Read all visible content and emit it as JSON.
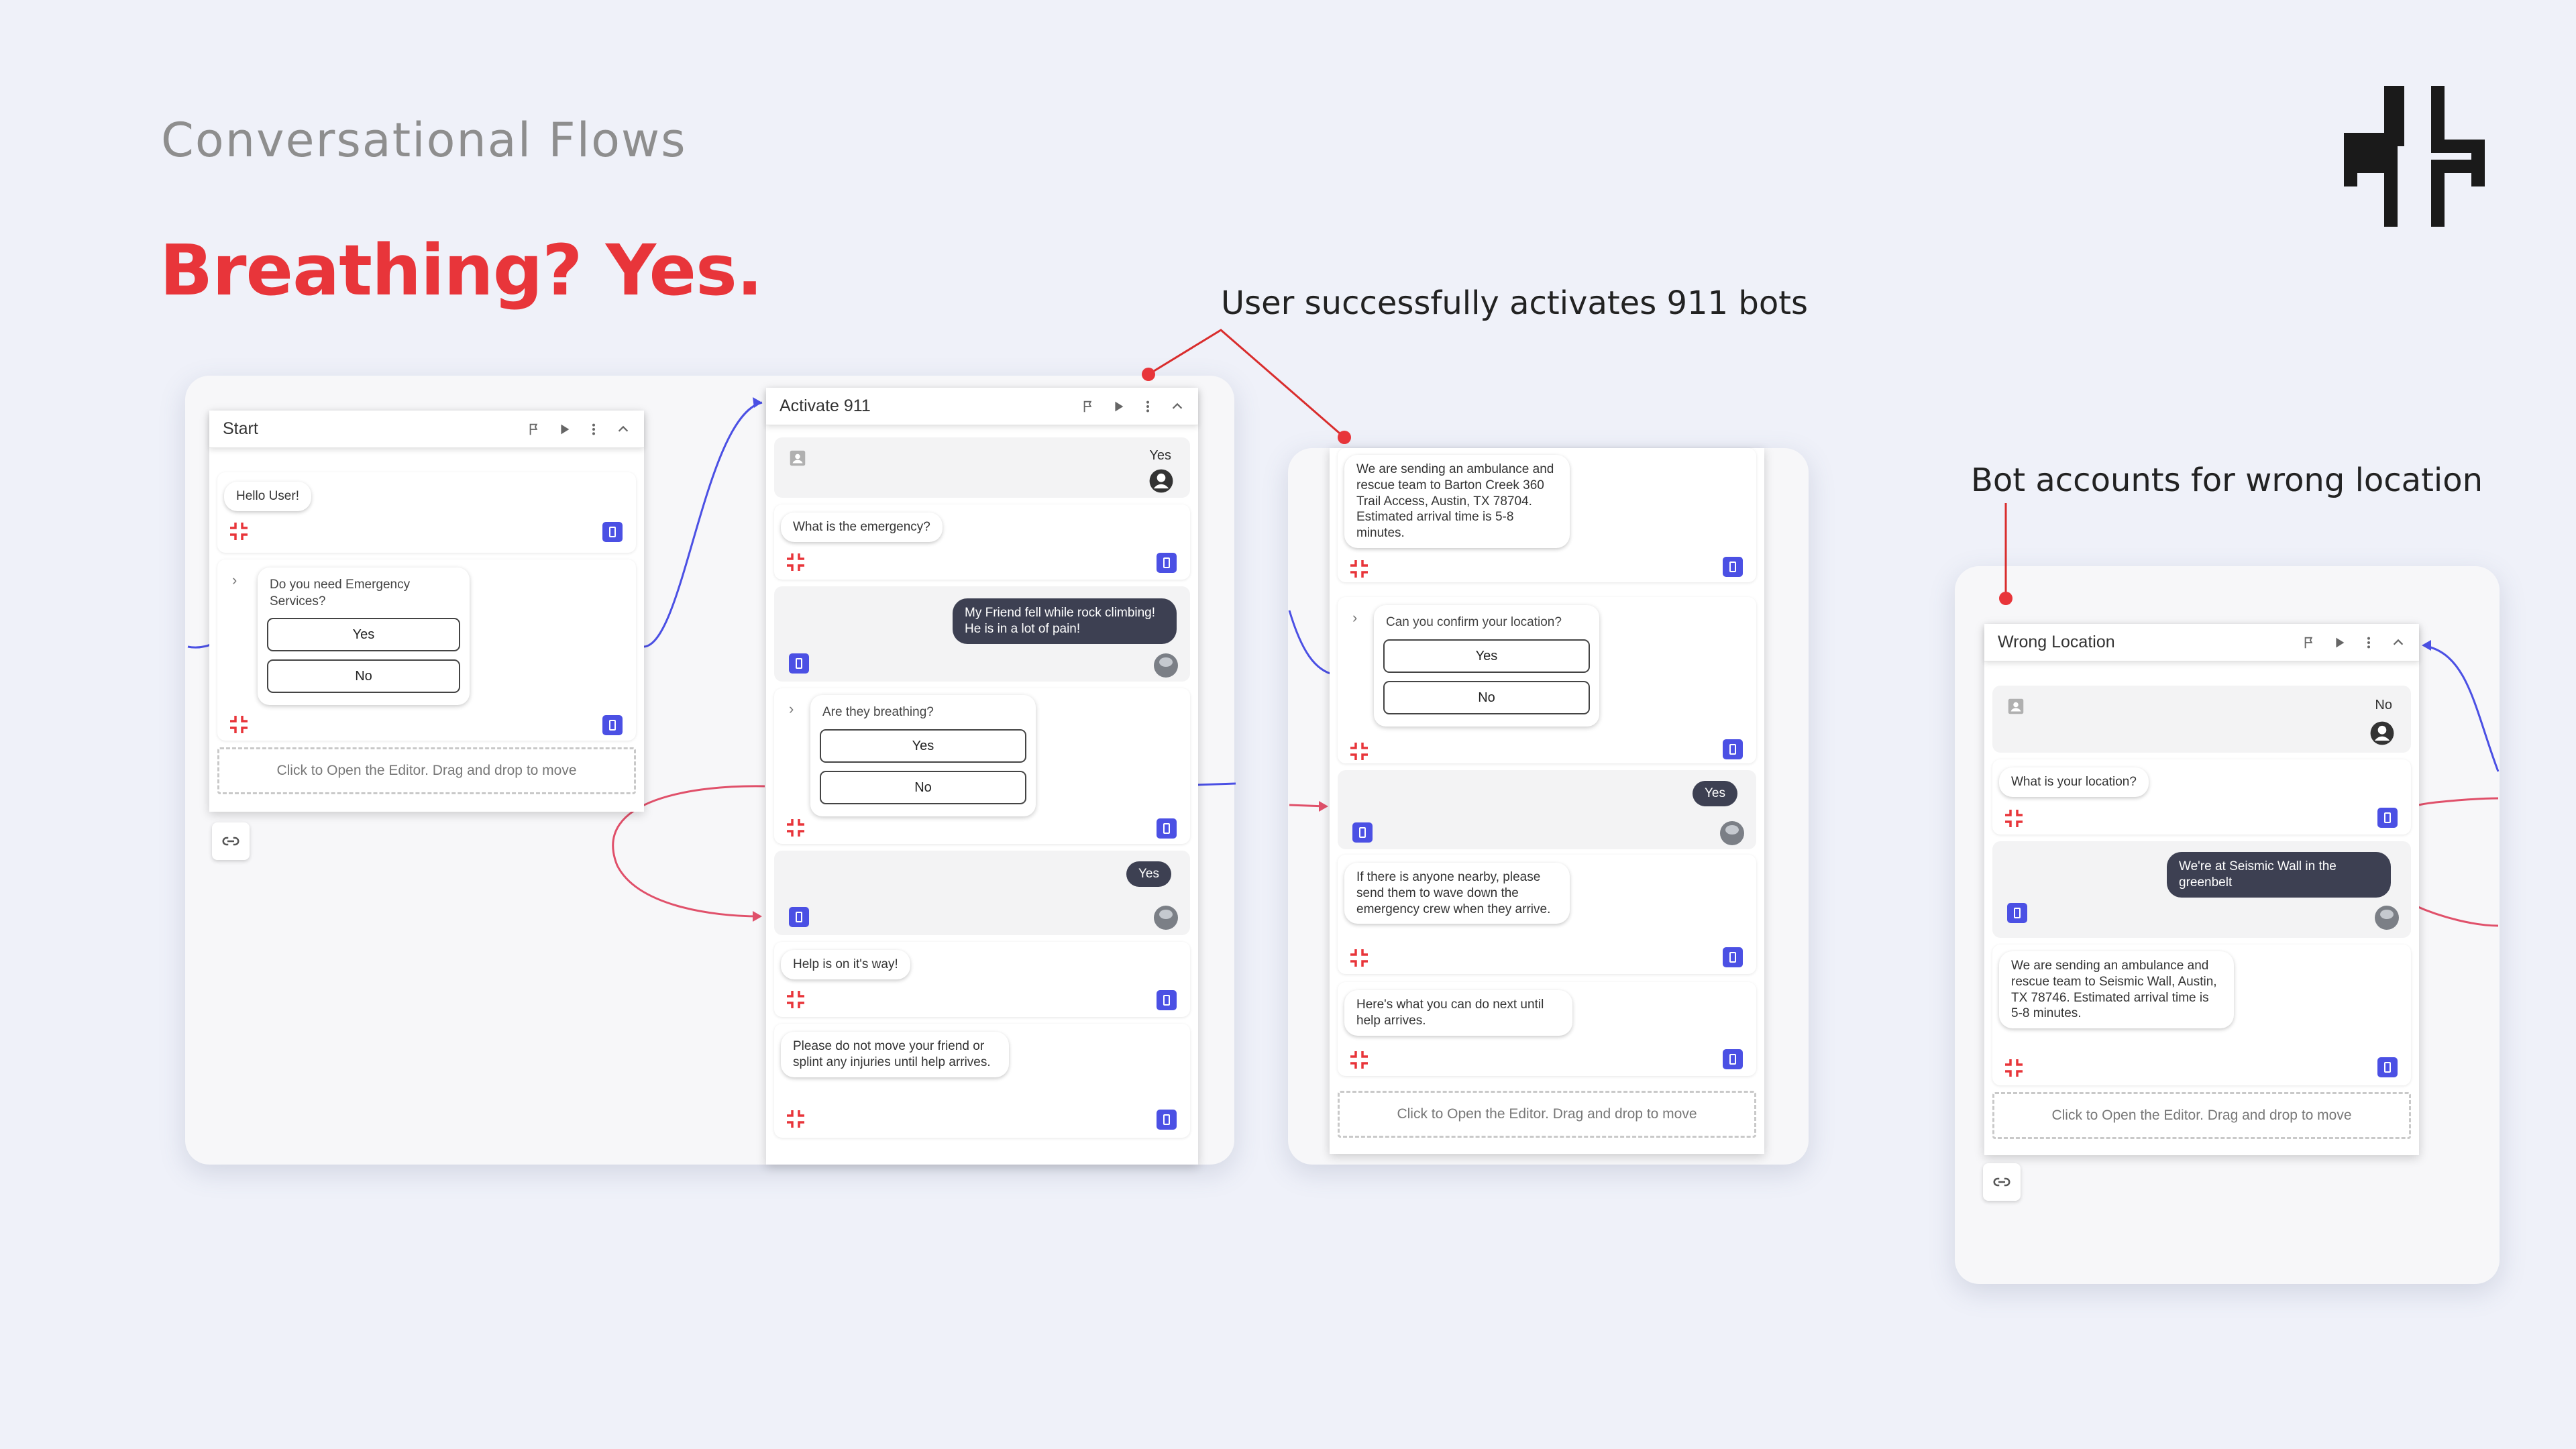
{
  "header": {
    "section_title": "Conversational Flows",
    "slide_title": "Breathing? Yes."
  },
  "annotations": {
    "activate": "User successfully activates 911 bots",
    "wrong_location": "Bot accounts for wrong location"
  },
  "colors": {
    "accent_red": "#e8353a",
    "dark_bubble": "#3d4052",
    "phone_blue": "#4b50e4",
    "connector_blue": "#4b50e4",
    "connector_pink": "#e0506a"
  },
  "icons": [
    "flag-icon",
    "play-icon",
    "more-vert-icon",
    "chevron-up-icon",
    "bot-cross-icon",
    "phone-icon",
    "user-circle-icon",
    "contact-card-icon",
    "link-icon",
    "brand-logo-icon"
  ],
  "start_flow": {
    "title": "Start",
    "greeting": "Hello User!",
    "question": "Do you need Emergency Services?",
    "choice_yes": "Yes",
    "choice_no": "No",
    "editor_hint": "Click to Open the Editor. Drag and drop to move"
  },
  "activate_flow": {
    "title": "Activate 911",
    "user_reply_1": "Yes",
    "bot_q1": "What is the emergency?",
    "user_msg": "My Friend fell while rock climbing! He is in a lot of pain!",
    "bot_q2": "Are they breathing?",
    "choice_yes": "Yes",
    "choice_no": "No",
    "user_reply_2": "Yes",
    "bot_msg_help": "Help is on it's way!",
    "bot_msg_advice": "Please do not move your friend or splint any injuries until help arrives."
  },
  "continue_flow": {
    "bot_msg_ambulance": "We are sending an ambulance and rescue team to Barton Creek 360 Trail Access, Austin, TX 78704. Estimated arrival time is 5-8 minutes.",
    "bot_q_confirm": "Can you confirm your location?",
    "choice_yes": "Yes",
    "choice_no": "No",
    "user_reply": "Yes",
    "bot_msg_nearby": "If there is anyone nearby, please send them to wave down the emergency crew when they arrive.",
    "bot_msg_next": "Here's what you can do next until help arrives.",
    "editor_hint": "Click to Open the Editor. Drag and drop to move"
  },
  "wrong_location_flow": {
    "title": "Wrong Location",
    "user_reply": "No",
    "bot_q": "What is your location?",
    "user_msg": "We're at Seismic Wall in the greenbelt",
    "bot_msg": "We are sending an ambulance and rescue team to Seismic Wall, Austin, TX 78746. Estimated arrival time is 5-8 minutes.",
    "editor_hint": "Click to Open the Editor. Drag and drop to move"
  }
}
